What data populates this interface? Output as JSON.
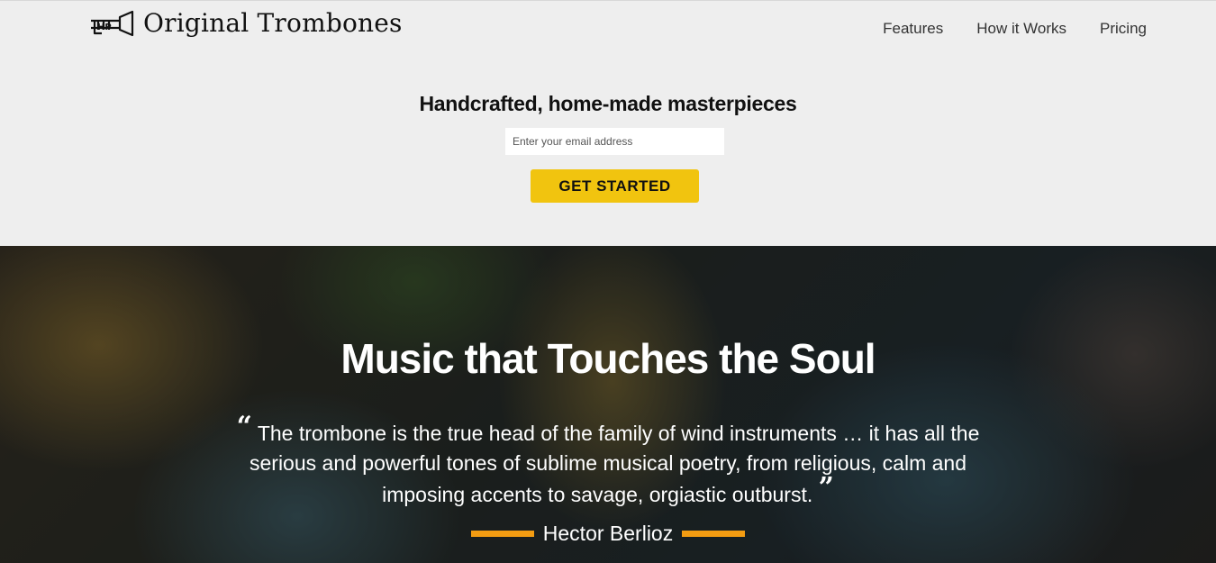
{
  "header": {
    "logo_text": "Original Trombones",
    "logo_icon": "trombone-icon",
    "nav": [
      "Features",
      "How it Works",
      "Pricing"
    ]
  },
  "signup": {
    "tagline": "Handcrafted, home-made masterpieces",
    "email_placeholder": "Enter your email address",
    "cta_label": "GET STARTED",
    "cta_color": "#f1c40f"
  },
  "hero": {
    "title": "Music that Touches the Soul",
    "quote_open": "“",
    "quote_text": "The trombone is the true head of the family of wind instruments … it has all the serious and powerful tones of sublime musical poetry, from religious, calm and imposing accents to savage, orgiastic outburst.",
    "quote_close": "”",
    "author": "Hector Berlioz",
    "accent_color": "#f39c12"
  }
}
